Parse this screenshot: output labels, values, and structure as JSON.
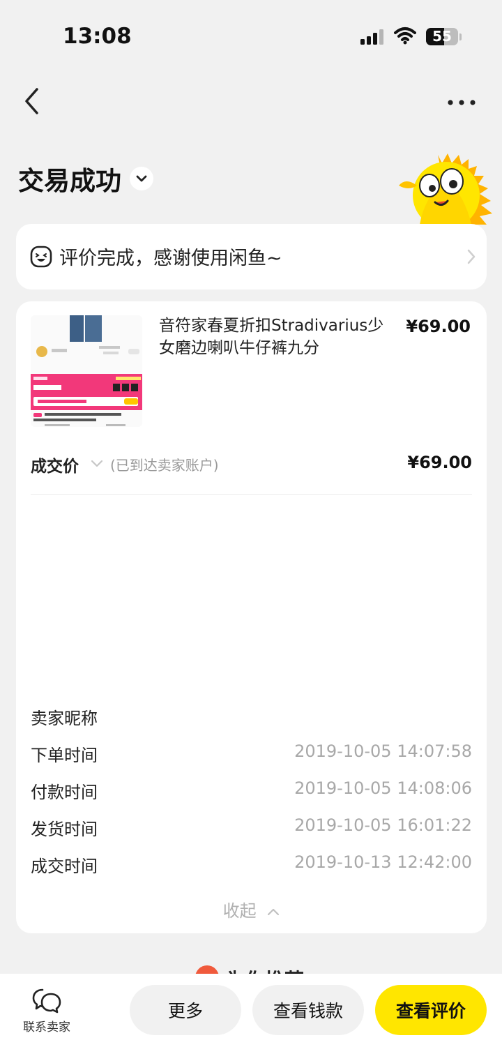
{
  "status_bar": {
    "time": "13:08",
    "battery": "55"
  },
  "header": {
    "title": "交易成功"
  },
  "review_banner": {
    "text": "评价完成，感谢使用闲鱼~"
  },
  "product": {
    "title": "音符家春夏折扣Stradivarius少女磨边喇叭牛仔裤九分",
    "price": "¥69.00"
  },
  "deal": {
    "label": "成交价",
    "note": "(已到达卖家账户)",
    "price": "¥69.00"
  },
  "info_rows": [
    {
      "label": "卖家昵称",
      "value": ""
    },
    {
      "label": "下单时间",
      "value": "2019-10-05 14:07:58"
    },
    {
      "label": "付款时间",
      "value": "2019-10-05 14:08:06"
    },
    {
      "label": "发货时间",
      "value": "2019-10-05 16:01:22"
    },
    {
      "label": "成交时间",
      "value": "2019-10-13 12:42:00"
    }
  ],
  "collapse_label": "收起",
  "recommend_label": "为你推荐",
  "bottom_bar": {
    "contact_label": "联系卖家",
    "more_label": "更多",
    "money_label": "查看钱款",
    "review_label": "查看评价"
  },
  "colors": {
    "accent_yellow": "#ffe600",
    "background": "#f1f1f1",
    "card": "#ffffff",
    "muted_text": "#a8a8a8"
  },
  "icons": [
    "signal-icon",
    "wifi-icon",
    "battery-icon",
    "back-arrow-icon",
    "more-dots-icon",
    "chevron-down-icon",
    "smiley-icon",
    "chevron-right-icon",
    "chevron-up-icon",
    "chat-bubble-icon",
    "fish-mascot"
  ]
}
